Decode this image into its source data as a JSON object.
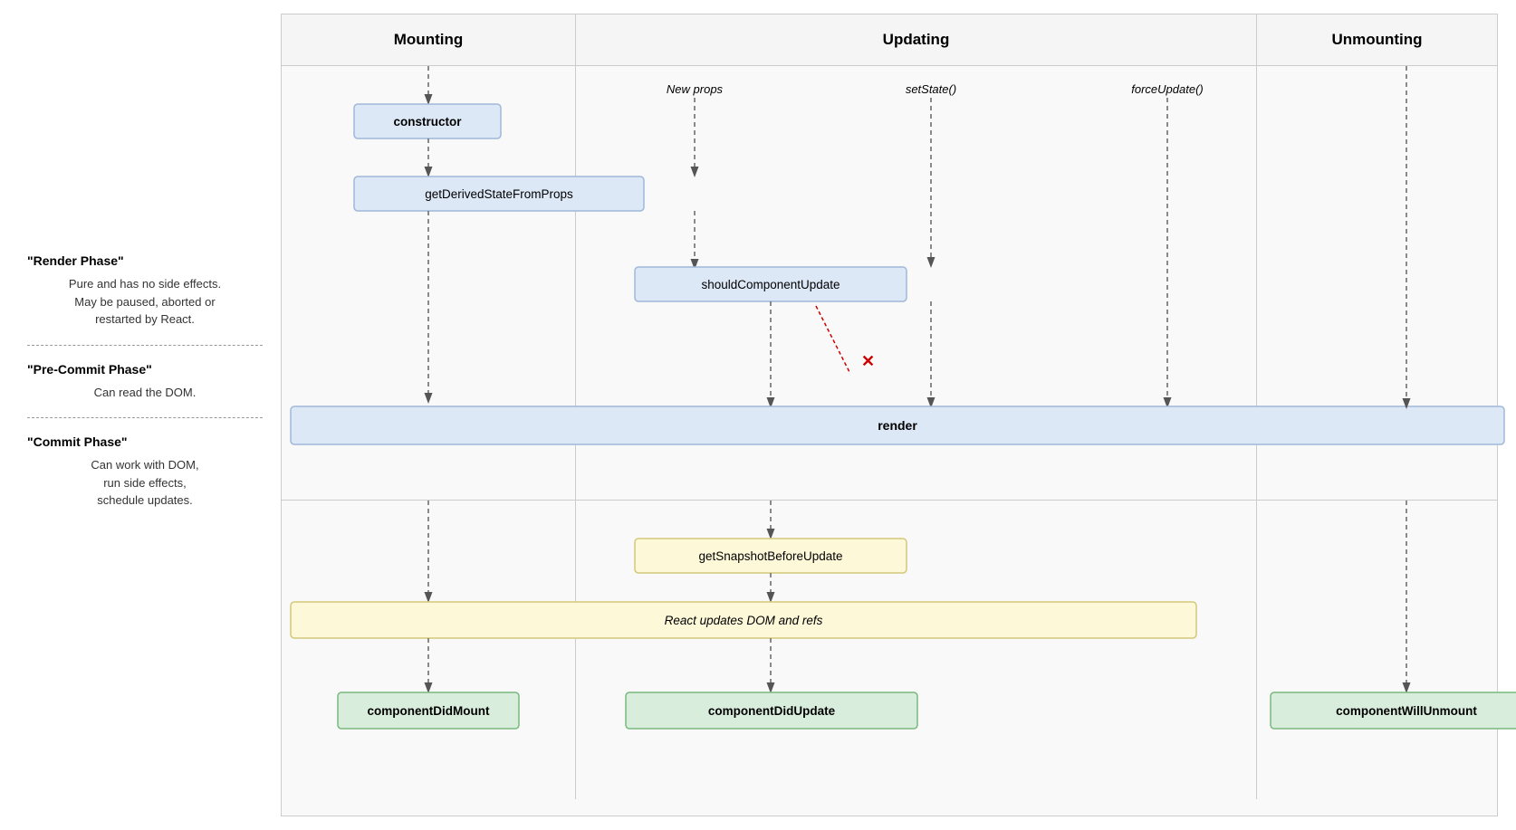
{
  "leftPanel": {
    "renderPhase": {
      "title": "\"Render Phase\"",
      "description": "Pure and has no side effects.\nMay be paused, aborted or\nrestarted by React."
    },
    "preCommitPhase": {
      "title": "\"Pre-Commit Phase\"",
      "description": "Can read the DOM."
    },
    "commitPhase": {
      "title": "\"Commit Phase\"",
      "description": "Can work with DOM,\nrun side effects,\nschedule updates."
    }
  },
  "columns": {
    "mounting": {
      "header": "Mounting"
    },
    "updating": {
      "header": "Updating",
      "subHeaders": [
        "New props",
        "setState()",
        "forceUpdate()"
      ]
    },
    "unmounting": {
      "header": "Unmounting"
    }
  },
  "boxes": {
    "constructor": "constructor",
    "getDerivedStateFromProps": "getDerivedStateFromProps",
    "shouldComponentUpdate": "shouldComponentUpdate",
    "render": "render",
    "getSnapshotBeforeUpdate": "getSnapshotBeforeUpdate",
    "reactUpdatesDOMAndRefs": "React updates DOM and refs",
    "componentDidMount": "componentDidMount",
    "componentDidUpdate": "componentDidUpdate",
    "componentWillUnmount": "componentWillUnmount"
  }
}
